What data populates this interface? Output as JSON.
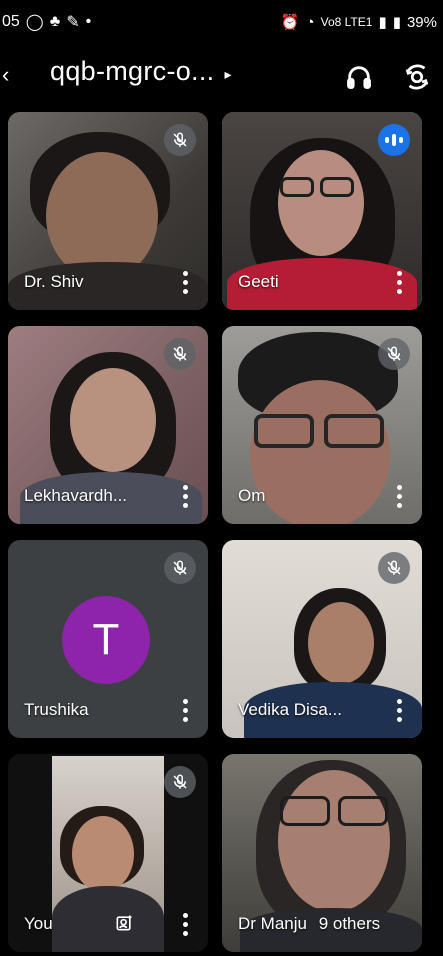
{
  "status_bar": {
    "time": "05",
    "left_icons": [
      "whatsapp-icon",
      "notification-icon",
      "notification-icon-2",
      "dot-icon"
    ],
    "signal_text": "Vo8 LTE1",
    "battery": "39%"
  },
  "header": {
    "title": "qqb-mgrc-o...",
    "title_caret": "▸",
    "icons": [
      "back-arrow-icon",
      "headphones-icon",
      "camera-flip-icon"
    ]
  },
  "tiles": [
    {
      "name": "Dr. Shiv",
      "state": "muted"
    },
    {
      "name": "Geeti",
      "state": "speaking"
    },
    {
      "name": "Lekhavardh...",
      "state": "muted"
    },
    {
      "name": "Om",
      "state": "muted"
    },
    {
      "name": "Trushika",
      "state": "muted",
      "avatar_initial": "T"
    },
    {
      "name": "Vedika Disa...",
      "state": "muted"
    },
    {
      "name": "You",
      "state": "muted"
    },
    {
      "name": "Dr Manju",
      "extra": "9 others",
      "state": "group"
    }
  ],
  "colors": {
    "tile_bg": "#3c4043",
    "active_border": "#20c4d8",
    "speaking_badge": "#1a73e8",
    "avatar_bg": "#8e24aa"
  }
}
